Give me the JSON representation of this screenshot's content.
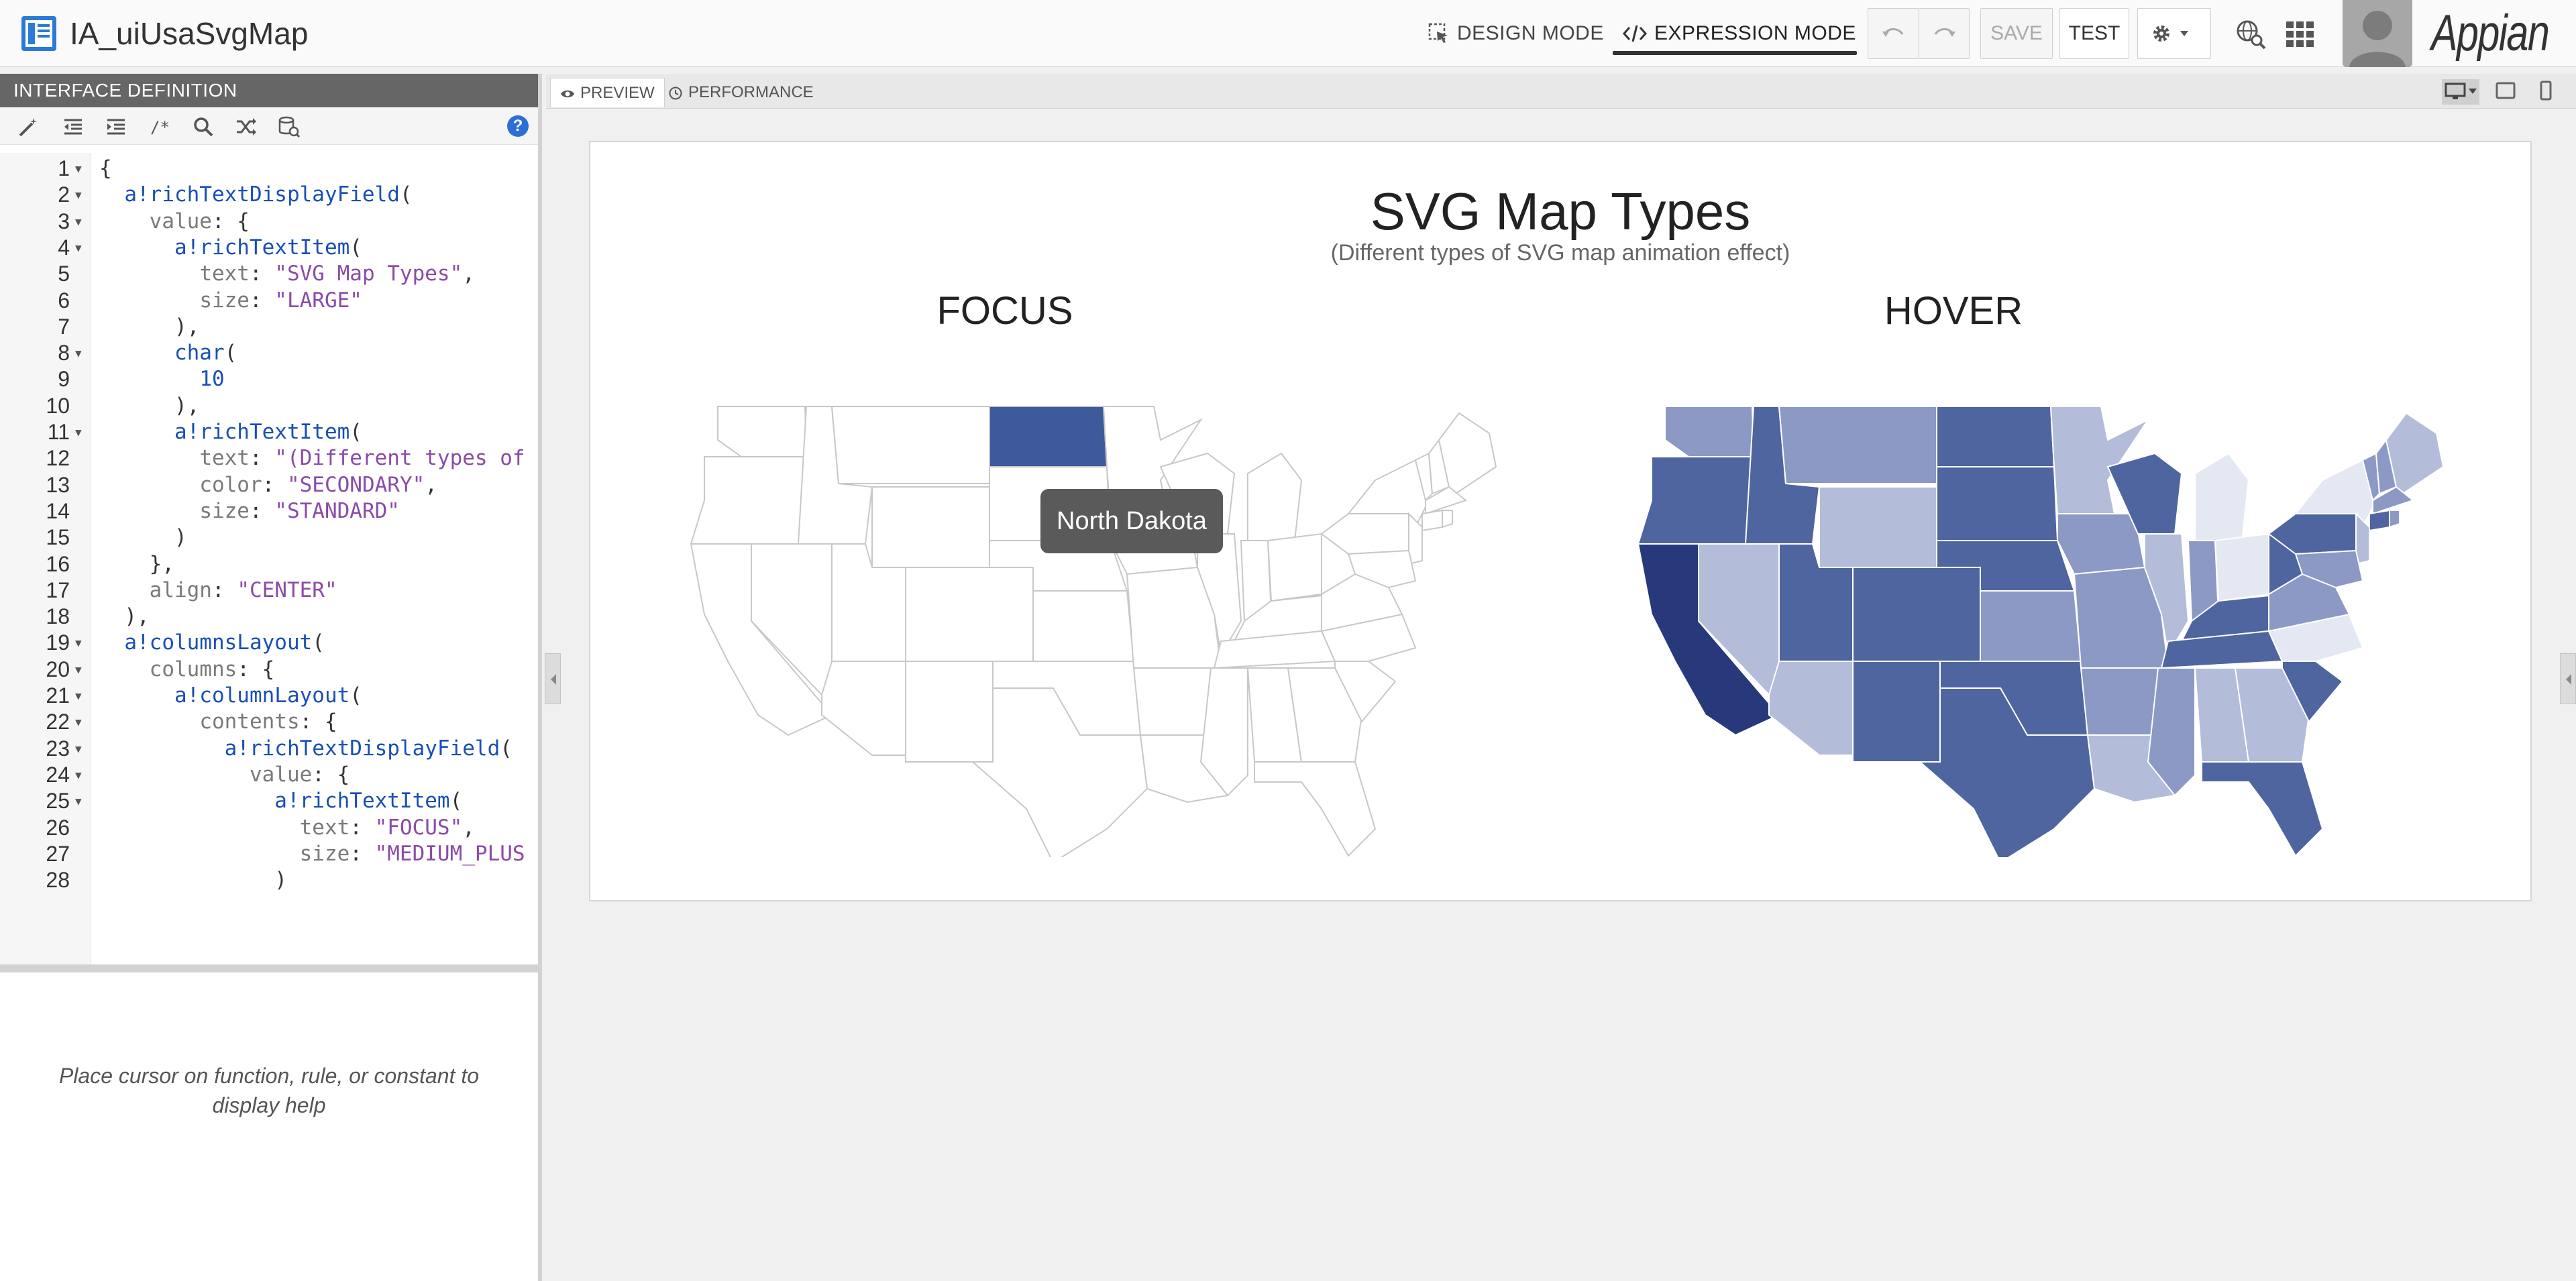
{
  "header": {
    "title": "IA_uiUsaSvgMap",
    "design_mode": "DESIGN MODE",
    "expression_mode": "EXPRESSION MODE",
    "save": "SAVE",
    "test": "TEST",
    "brand": "Appian"
  },
  "left_panel": {
    "title": "INTERFACE DEFINITION",
    "help_text": "Place cursor on function, rule, or constant to display help"
  },
  "code": [
    {
      "n": "1",
      "fold": true,
      "t": [
        [
          "",
          "{"
        ]
      ]
    },
    {
      "n": "2",
      "fold": true,
      "t": [
        [
          "",
          "  "
        ],
        [
          "fn",
          "a!richTextDisplayField"
        ],
        [
          "",
          "("
        ]
      ]
    },
    {
      "n": "3",
      "fold": true,
      "t": [
        [
          "",
          "    "
        ],
        [
          "key",
          "value"
        ],
        [
          "",
          ": {"
        ]
      ]
    },
    {
      "n": "4",
      "fold": true,
      "t": [
        [
          "",
          "      "
        ],
        [
          "fn",
          "a!richTextItem"
        ],
        [
          "",
          "("
        ]
      ]
    },
    {
      "n": "5",
      "fold": false,
      "t": [
        [
          "",
          "        "
        ],
        [
          "key",
          "text"
        ],
        [
          "",
          ": "
        ],
        [
          "str",
          "\"SVG Map Types\""
        ],
        [
          "",
          ","
        ]
      ]
    },
    {
      "n": "6",
      "fold": false,
      "t": [
        [
          "",
          "        "
        ],
        [
          "key",
          "size"
        ],
        [
          "",
          ": "
        ],
        [
          "str",
          "\"LARGE\""
        ]
      ]
    },
    {
      "n": "7",
      "fold": false,
      "t": [
        [
          "",
          "      ),"
        ]
      ]
    },
    {
      "n": "8",
      "fold": true,
      "t": [
        [
          "",
          "      "
        ],
        [
          "fn",
          "char"
        ],
        [
          "",
          "("
        ]
      ]
    },
    {
      "n": "9",
      "fold": false,
      "t": [
        [
          "",
          "        "
        ],
        [
          "num",
          "10"
        ]
      ]
    },
    {
      "n": "10",
      "fold": false,
      "t": [
        [
          "",
          "      ),"
        ]
      ]
    },
    {
      "n": "11",
      "fold": true,
      "t": [
        [
          "",
          "      "
        ],
        [
          "fn",
          "a!richTextItem"
        ],
        [
          "",
          "("
        ]
      ]
    },
    {
      "n": "12",
      "fold": false,
      "t": [
        [
          "",
          "        "
        ],
        [
          "key",
          "text"
        ],
        [
          "",
          ": "
        ],
        [
          "str",
          "\"(Different types of"
        ]
      ]
    },
    {
      "n": "13",
      "fold": false,
      "t": [
        [
          "",
          "        "
        ],
        [
          "key",
          "color"
        ],
        [
          "",
          ": "
        ],
        [
          "str",
          "\"SECONDARY\""
        ],
        [
          "",
          ","
        ]
      ]
    },
    {
      "n": "14",
      "fold": false,
      "t": [
        [
          "",
          "        "
        ],
        [
          "key",
          "size"
        ],
        [
          "",
          ": "
        ],
        [
          "str",
          "\"STANDARD\""
        ]
      ]
    },
    {
      "n": "15",
      "fold": false,
      "t": [
        [
          "",
          "      )"
        ]
      ]
    },
    {
      "n": "16",
      "fold": false,
      "t": [
        [
          "",
          "    },"
        ]
      ]
    },
    {
      "n": "17",
      "fold": false,
      "t": [
        [
          "",
          "    "
        ],
        [
          "key",
          "align"
        ],
        [
          "",
          ": "
        ],
        [
          "str",
          "\"CENTER\""
        ]
      ]
    },
    {
      "n": "18",
      "fold": false,
      "t": [
        [
          "",
          "  ),"
        ]
      ]
    },
    {
      "n": "19",
      "fold": true,
      "t": [
        [
          "",
          "  "
        ],
        [
          "fn",
          "a!columnsLayout"
        ],
        [
          "",
          "("
        ]
      ]
    },
    {
      "n": "20",
      "fold": true,
      "t": [
        [
          "",
          "    "
        ],
        [
          "key",
          "columns"
        ],
        [
          "",
          ": {"
        ]
      ]
    },
    {
      "n": "21",
      "fold": true,
      "t": [
        [
          "",
          "      "
        ],
        [
          "fn",
          "a!columnLayout"
        ],
        [
          "",
          "("
        ]
      ]
    },
    {
      "n": "22",
      "fold": true,
      "t": [
        [
          "",
          "        "
        ],
        [
          "key",
          "contents"
        ],
        [
          "",
          ": {"
        ]
      ]
    },
    {
      "n": "23",
      "fold": true,
      "t": [
        [
          "",
          "          "
        ],
        [
          "fn",
          "a!richTextDisplayField"
        ],
        [
          "",
          "("
        ]
      ]
    },
    {
      "n": "24",
      "fold": true,
      "t": [
        [
          "",
          "            "
        ],
        [
          "key",
          "value"
        ],
        [
          "",
          ": {"
        ]
      ]
    },
    {
      "n": "25",
      "fold": true,
      "t": [
        [
          "",
          "              "
        ],
        [
          "fn",
          "a!richTextItem"
        ],
        [
          "",
          "("
        ]
      ]
    },
    {
      "n": "26",
      "fold": false,
      "t": [
        [
          "",
          "                "
        ],
        [
          "key",
          "text"
        ],
        [
          "",
          ": "
        ],
        [
          "str",
          "\"FOCUS\""
        ],
        [
          "",
          ","
        ]
      ]
    },
    {
      "n": "27",
      "fold": false,
      "t": [
        [
          "",
          "                "
        ],
        [
          "key",
          "size"
        ],
        [
          "",
          ": "
        ],
        [
          "str",
          "\"MEDIUM_PLUS"
        ]
      ]
    },
    {
      "n": "28",
      "fold": false,
      "t": [
        [
          "",
          "              )"
        ]
      ]
    }
  ],
  "tabs": {
    "preview": "PREVIEW",
    "performance": "PERFORMANCE"
  },
  "preview": {
    "title": "SVG Map Types",
    "subtitle": "(Different types of SVG map animation effect)",
    "col1_title": "FOCUS",
    "col2_title": "HOVER",
    "tooltip": "North Dakota"
  },
  "colors": {
    "focus_highlight": "#3f5a9a",
    "dark": "#27397a",
    "mid": "#4f65a0",
    "light": "#8c99c4",
    "lighter": "#b3bcd9",
    "pale": "#e4e8f2"
  },
  "icons": [
    "interface-icon",
    "design-mode-icon",
    "expression-mode-icon",
    "undo-icon",
    "redo-icon",
    "gear-icon",
    "search-globe-icon",
    "apps-grid-icon",
    "avatar-icon"
  ]
}
